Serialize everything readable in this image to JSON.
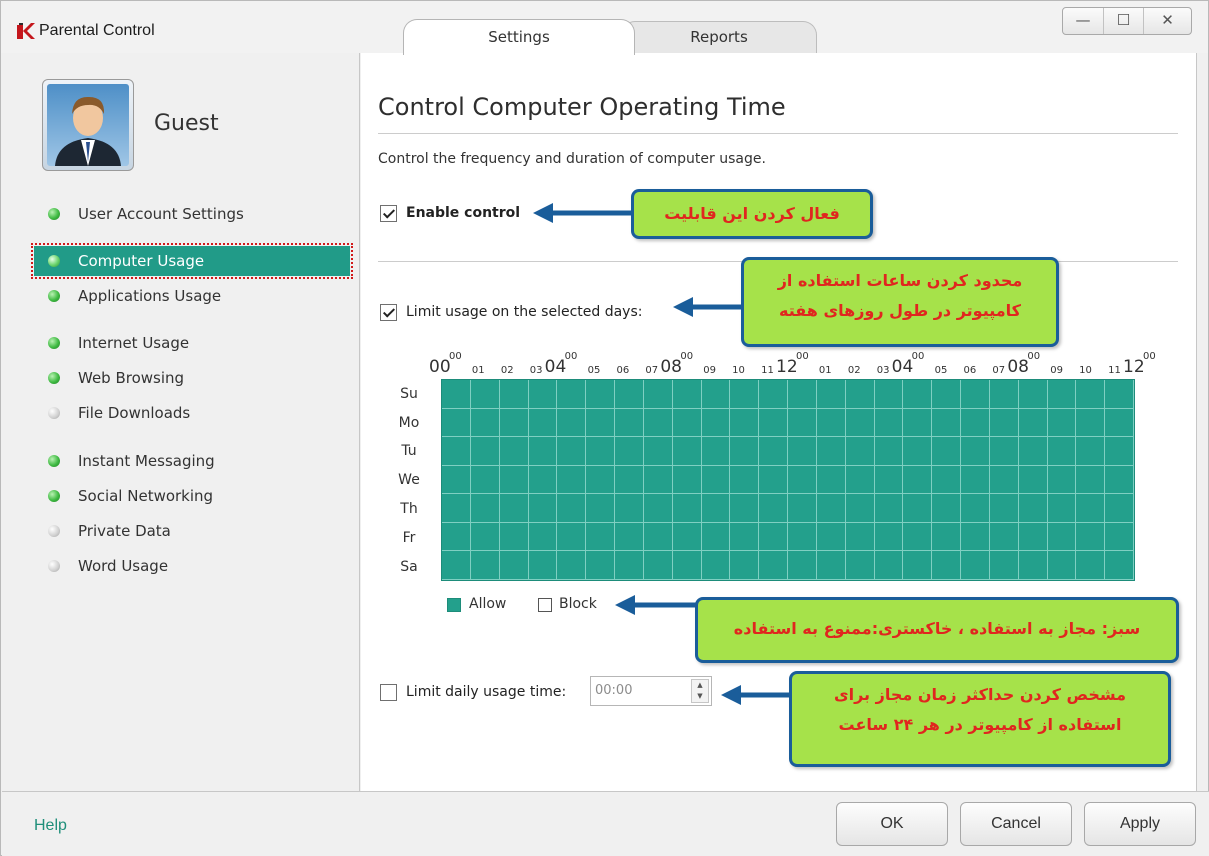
{
  "window": {
    "title": "Parental Control",
    "controls": {
      "minimize": "—",
      "maximize": "☐",
      "close": "✕"
    }
  },
  "tabs": [
    {
      "label": "Settings",
      "active": true
    },
    {
      "label": "Reports",
      "active": false
    }
  ],
  "user": {
    "name": "Guest"
  },
  "sidebar": {
    "items": [
      {
        "label": "User Account Settings",
        "status": "green"
      },
      {
        "label": "Computer Usage",
        "status": "green",
        "selected": true
      },
      {
        "label": "Applications Usage",
        "status": "green"
      },
      {
        "label": "Internet Usage",
        "status": "green"
      },
      {
        "label": "Web Browsing",
        "status": "green"
      },
      {
        "label": "File Downloads",
        "status": "grey"
      },
      {
        "label": "Instant Messaging",
        "status": "green"
      },
      {
        "label": "Social Networking",
        "status": "green"
      },
      {
        "label": "Private Data",
        "status": "grey"
      },
      {
        "label": "Word Usage",
        "status": "grey"
      }
    ]
  },
  "main": {
    "title": "Control Computer Operating Time",
    "description": "Control the frequency and duration of computer usage.",
    "enable_control": {
      "label": "Enable control",
      "checked": true
    },
    "limit_days": {
      "label": "Limit usage on the selected days:",
      "checked": true
    },
    "hours": {
      "sup": "00",
      "labels": [
        "00",
        "01",
        "02",
        "03",
        "04",
        "05",
        "06",
        "07",
        "08",
        "09",
        "10",
        "11",
        "12",
        "01",
        "02",
        "03",
        "04",
        "05",
        "06",
        "07",
        "08",
        "09",
        "10",
        "11",
        "12"
      ]
    },
    "days": [
      "Su",
      "Mo",
      "Tu",
      "We",
      "Th",
      "Fr",
      "Sa"
    ],
    "legend": {
      "allow": "Allow",
      "block": "Block",
      "allow_color": "#23a08c"
    },
    "daily_limit": {
      "label": "Limit daily usage time:",
      "checked": false,
      "value": "00:00"
    }
  },
  "annotations": {
    "enable": "فعال کردن این قابلیت",
    "days_line1": "محدود کردن ساعات استفاده از",
    "days_line2": "کامپیوتر در طول روزهای هفته",
    "legend": "سبز: مجاز به استفاده ، خاکستری:ممنوع به استفاده",
    "daily_line1": "مشخص کردن حداکثر زمان مجاز برای",
    "daily_line2": "استفاده از کامپیوتر در هر ۲۴ ساعت"
  },
  "footer": {
    "help": "Help",
    "ok": "OK",
    "cancel": "Cancel",
    "apply": "Apply"
  }
}
